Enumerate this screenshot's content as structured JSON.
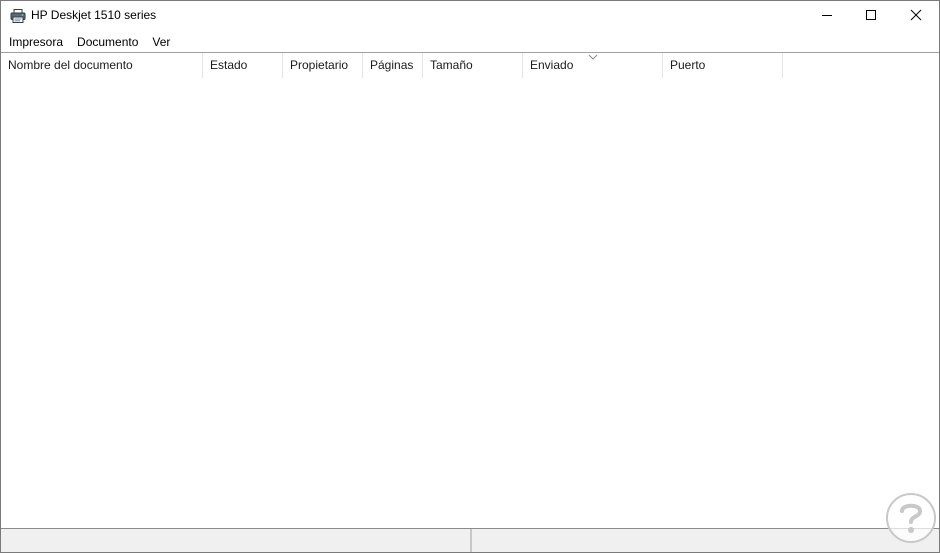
{
  "window": {
    "title": "HP Deskjet 1510 series",
    "icon": "printer-icon",
    "controls": [
      "minimize-icon",
      "maximize-icon",
      "close-icon"
    ]
  },
  "menu": {
    "items": [
      {
        "label": "Impresora"
      },
      {
        "label": "Documento"
      },
      {
        "label": "Ver"
      }
    ]
  },
  "queue": {
    "columns": [
      {
        "label": "Nombre del documento"
      },
      {
        "label": "Estado"
      },
      {
        "label": "Propietario"
      },
      {
        "label": "Páginas"
      },
      {
        "label": "Tamaño"
      },
      {
        "label": "Enviado",
        "sort": "descending"
      },
      {
        "label": "Puerto"
      }
    ],
    "rows": []
  },
  "statusbar": {
    "left": "",
    "right": ""
  },
  "colors": {
    "window_bg": "#ffffff",
    "border": "#7a7a7a",
    "statusbar_bg": "#f0f0f0",
    "watermark": "#c8c8c8"
  }
}
